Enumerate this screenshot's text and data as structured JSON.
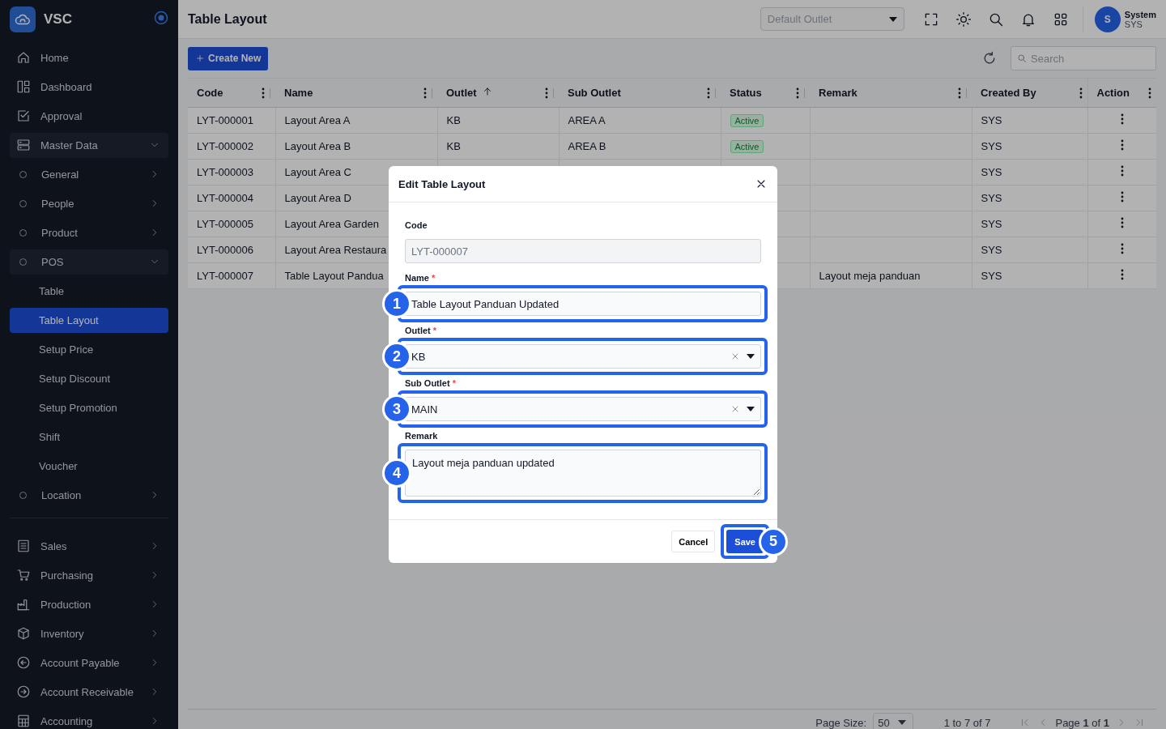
{
  "sidebar": {
    "brand": "VSC",
    "menu": [
      {
        "label": "Home",
        "selected": false
      },
      {
        "label": "Dashboard",
        "selected": false
      },
      {
        "label": "Approval",
        "selected": false
      },
      {
        "label": "Master Data",
        "selected": false,
        "expanded": true,
        "children": [
          {
            "label": "General",
            "selected": false,
            "expanded": false
          },
          {
            "label": "People",
            "selected": false,
            "expanded": false
          },
          {
            "label": "Product",
            "selected": false,
            "expanded": false
          },
          {
            "label": "POS",
            "selected": false,
            "expanded": true,
            "children": [
              {
                "label": "Table",
                "selected": false
              },
              {
                "label": "Table Layout",
                "selected": true
              },
              {
                "label": "Setup Price",
                "selected": false
              },
              {
                "label": "Setup Discount",
                "selected": false
              },
              {
                "label": "Setup Promotion",
                "selected": false
              },
              {
                "label": "Shift",
                "selected": false
              },
              {
                "label": "Voucher",
                "selected": false
              }
            ]
          },
          {
            "label": "Location",
            "selected": false,
            "expanded": false
          }
        ]
      }
    ],
    "menu_2": [
      {
        "label": "Sales",
        "selected": false,
        "expanded": false
      },
      {
        "label": "Purchasing",
        "selected": false,
        "expanded": false
      },
      {
        "label": "Production",
        "selected": false,
        "expanded": false
      },
      {
        "label": "Inventory",
        "selected": false,
        "expanded": false
      },
      {
        "label": "Account Payable",
        "selected": false,
        "expanded": false
      },
      {
        "label": "Account Receivable",
        "selected": false,
        "expanded": false
      },
      {
        "label": "Accounting",
        "selected": false,
        "expanded": false
      }
    ]
  },
  "header": {
    "title": "Table Layout",
    "outlet_select": {
      "placeholder": "Default Outlet"
    },
    "user": {
      "initial": "S",
      "name": "System",
      "code": "SYS"
    }
  },
  "toolbar": {
    "create_button": "Create New",
    "search": {
      "placeholder": "Search"
    }
  },
  "table": {
    "columns": [
      {
        "label": "Code",
        "sorted": false
      },
      {
        "label": "Name",
        "sorted": false
      },
      {
        "label": "Outlet",
        "sorted": true
      },
      {
        "label": "Sub Outlet",
        "sorted": false
      },
      {
        "label": "Status",
        "sorted": false
      },
      {
        "label": "Remark",
        "sorted": false
      },
      {
        "label": "Created By",
        "sorted": false
      },
      {
        "label": "Action",
        "sorted": false
      }
    ],
    "rows": [
      {
        "code": "LYT-000001",
        "name": "Layout Area A",
        "outlet": "KB",
        "sub_outlet": "AREA A",
        "status": "Active",
        "created_by": "SYS"
      },
      {
        "code": "LYT-000002",
        "name": "Layout Area B",
        "outlet": "KB",
        "sub_outlet": "AREA B",
        "status": "Active",
        "created_by": "SYS"
      },
      {
        "code": "LYT-000003",
        "name": "Layout Area C",
        "created_by": "SYS"
      },
      {
        "code": "LYT-000004",
        "name": "Layout Area D",
        "created_by": "SYS"
      },
      {
        "code": "LYT-000005",
        "name": "Layout Area Garden",
        "created_by": "SYS"
      },
      {
        "code": "LYT-000006",
        "name": "Layout Area Restaura",
        "created_by": "SYS"
      },
      {
        "code": "LYT-000007",
        "name": "Table Layout Pandua",
        "remark": "Layout meja panduan",
        "created_by": "SYS"
      }
    ]
  },
  "pagination": {
    "page_size_label": "Page Size:",
    "page_size": "50",
    "range": "1 to 7 of 7",
    "page": "Page **1** of **1**"
  },
  "modal": {
    "title": "Edit Table Layout",
    "fields": [
      {
        "kind": "text",
        "label": "Code",
        "disabled": true,
        "value": "LYT-000007"
      },
      {
        "kind": "text",
        "label": "Name",
        "required_mark": "*",
        "disabled": false,
        "value": "Table Layout Panduan Updated",
        "callout": "1"
      },
      {
        "kind": "select",
        "label": "Outlet",
        "required_mark": "*",
        "value": "KB",
        "callout": "2"
      },
      {
        "kind": "select",
        "label": "Sub Outlet",
        "required_mark": "*",
        "value": "MAIN",
        "callout": "3"
      },
      {
        "kind": "textarea",
        "label": "Remark",
        "value": "Layout meja panduan updated",
        "callout": "4"
      }
    ],
    "cancel_button": "Cancel",
    "save_button": {
      "label": "Save",
      "callout": "5"
    }
  }
}
